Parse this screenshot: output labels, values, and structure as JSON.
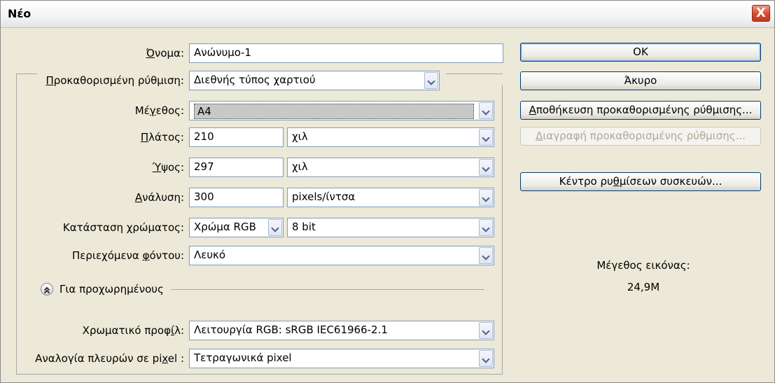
{
  "window": {
    "title": "Νέο",
    "close_glyph": "X"
  },
  "form": {
    "name_label_pre": "",
    "name_label_u": "Ό",
    "name_label_post": "νομα:",
    "name_value": "Ανώνυμο-1",
    "preset_label_u": "Π",
    "preset_label_post": "ροκαθορισμένη ρύθμιση:",
    "preset_value": "Διεθνής τύπος χαρτιού",
    "size_label_pre": "Μέ",
    "size_label_u": "γ",
    "size_label_post": "εθος:",
    "size_value": "A4",
    "width_label_u": "Π",
    "width_label_post": "λάτος:",
    "width_value": "210",
    "width_unit": "χιλ",
    "height_label_u": "Ύ",
    "height_label_post": "ψος:",
    "height_value": "297",
    "height_unit": "χιλ",
    "resolution_label_u": "Α",
    "resolution_label_post": "νάλυση:",
    "resolution_value": "300",
    "resolution_unit": "pixels/ίντσα",
    "colormode_label_pre": "Κατάσταση ",
    "colormode_label_u": "χ",
    "colormode_label_post": "ρώματος:",
    "colormode_value": "Χρώμα RGB",
    "bitdepth_value": "8 bit",
    "background_label_pre": "Περιεχόμενα ",
    "background_label_u": "φ",
    "background_label_post": "όντου:",
    "background_value": "Λευκό",
    "advanced_label": "Για προχωρημένους",
    "profile_label_pre": "Χρωματικό προφ",
    "profile_label_u": "ί",
    "profile_label_post": "λ:",
    "profile_value": "Λειτουργία RGB:  sRGB IEC61966-2.1",
    "aspect_label_pre": "Αναλογία πλευρών σε pi",
    "aspect_label_u": "x",
    "aspect_label_post": "el :",
    "aspect_value": "Τετραγωνικά pixel"
  },
  "buttons": {
    "ok": "OK",
    "cancel": "Άκυρο",
    "save_preset_u": "Α",
    "save_preset_post": "ποθήκευση προκαθορισμένης ρύθμισης...",
    "delete_preset_u": "Δ",
    "delete_preset_post": "ιαγραφή προκαθορισμένης ρύθμισης...",
    "device_central_pre": "Κέντρο ρυ",
    "device_central_u": "θ",
    "device_central_post": "μίσεων συσκευών..."
  },
  "image_size": {
    "label": "Μέγεθος εικόνας:",
    "value": "24,9M"
  }
}
